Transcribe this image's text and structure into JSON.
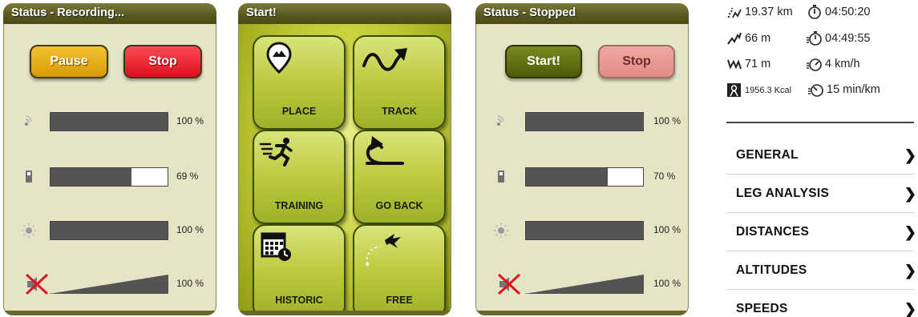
{
  "screen_recording": {
    "title": "Status - Recording...",
    "buttons": {
      "left": "Pause",
      "right": "Stop"
    },
    "rows": [
      {
        "icon": "gps-signal-icon",
        "percent": "100 %",
        "level": 1.0
      },
      {
        "icon": "battery-icon",
        "percent": "69 %",
        "level": 0.69
      },
      {
        "icon": "brightness-icon",
        "percent": "100 %",
        "level": 1.0
      },
      {
        "icon": "volume-muted-icon",
        "percent": "100 %",
        "level": 1.0
      }
    ]
  },
  "screen_start": {
    "title": "Start!",
    "items": [
      {
        "label": "PLACE",
        "icon": "place-pin-icon"
      },
      {
        "label": "TRACK",
        "icon": "track-arrow-icon"
      },
      {
        "label": "TRAINING",
        "icon": "runner-icon"
      },
      {
        "label": "GO BACK",
        "icon": "go-back-icon"
      },
      {
        "label": "HISTORIC",
        "icon": "calendar-icon"
      },
      {
        "label": "FREE",
        "icon": "bird-icon"
      }
    ]
  },
  "screen_stopped": {
    "title": "Status - Stopped",
    "buttons": {
      "left": "Start!",
      "right": "Stop"
    },
    "rows": [
      {
        "icon": "gps-signal-icon",
        "percent": "100 %",
        "level": 1.0
      },
      {
        "icon": "battery-icon",
        "percent": "70 %",
        "level": 0.7
      },
      {
        "icon": "brightness-icon",
        "percent": "100 %",
        "level": 1.0
      },
      {
        "icon": "volume-muted-icon",
        "percent": "100 %",
        "level": 1.0
      }
    ]
  },
  "stats": {
    "distance": "19.37 km",
    "total_time": "04:50:20",
    "ascent": "66 m",
    "moving_time": "04:49:55",
    "descent": "71 m",
    "avg_speed": "4 km/h",
    "calories": "1956.3 Kcal",
    "avg_pace": "15 min/km",
    "sections": [
      "GENERAL",
      "LEG ANALYSIS",
      "DISTANCES",
      "ALTITUDES",
      "SPEEDS"
    ]
  }
}
